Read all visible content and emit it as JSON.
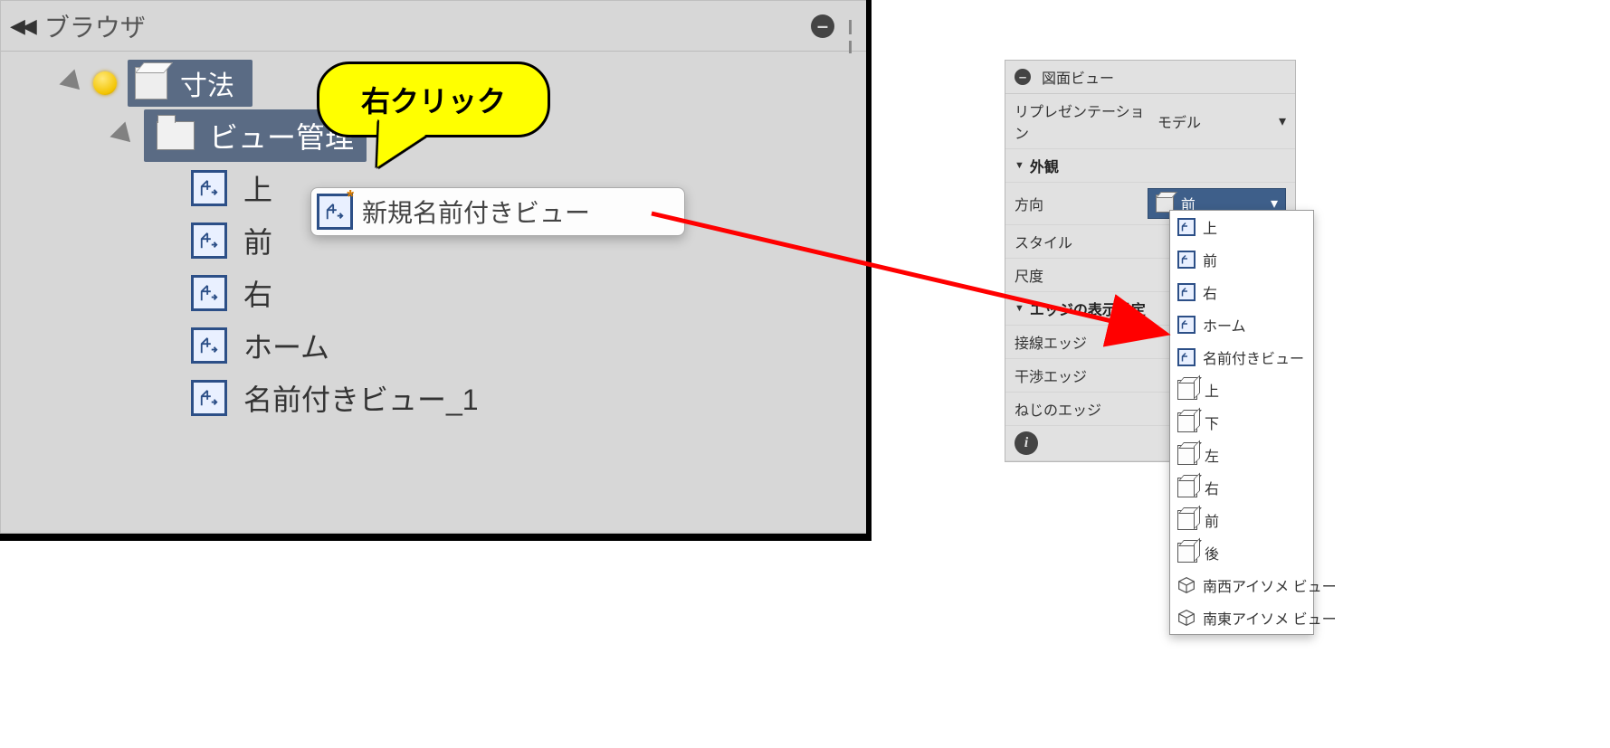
{
  "callout": {
    "label": "右クリック"
  },
  "browser": {
    "title": "ブラウザ",
    "tree": {
      "dim_label": "寸法",
      "view_mgmt": "ビュー管理",
      "items": [
        {
          "label": "上"
        },
        {
          "label": "前"
        },
        {
          "label": "右"
        },
        {
          "label": "ホーム"
        },
        {
          "label": "名前付きビュー_1"
        }
      ]
    },
    "context_menu": {
      "label": "新規名前付きビュー"
    }
  },
  "right": {
    "header": "図面ビュー",
    "representation_label": "リプレゼンテーション",
    "representation_value": "モデル",
    "appearance_section": "外観",
    "direction_label": "方向",
    "direction_value": "前",
    "style_label": "スタイル",
    "scale_label": "尺度",
    "edge_section": "エッジの表示設定",
    "tangent_label": "接線エッジ",
    "interference_label": "干渉エッジ",
    "thread_label": "ねじのエッジ"
  },
  "dropdown": {
    "items": [
      {
        "icon": "view",
        "label": "上"
      },
      {
        "icon": "view",
        "label": "前"
      },
      {
        "icon": "view",
        "label": "右"
      },
      {
        "icon": "view",
        "label": "ホーム"
      },
      {
        "icon": "view",
        "label": "名前付きビュー"
      },
      {
        "icon": "wire",
        "label": "上"
      },
      {
        "icon": "wire",
        "label": "下"
      },
      {
        "icon": "wire",
        "label": "左"
      },
      {
        "icon": "wire",
        "label": "右"
      },
      {
        "icon": "wire",
        "label": "前"
      },
      {
        "icon": "wire",
        "label": "後"
      },
      {
        "icon": "iso",
        "label": "南西アイソメ ビュー"
      },
      {
        "icon": "iso",
        "label": "南東アイソメ ビュー"
      }
    ]
  }
}
